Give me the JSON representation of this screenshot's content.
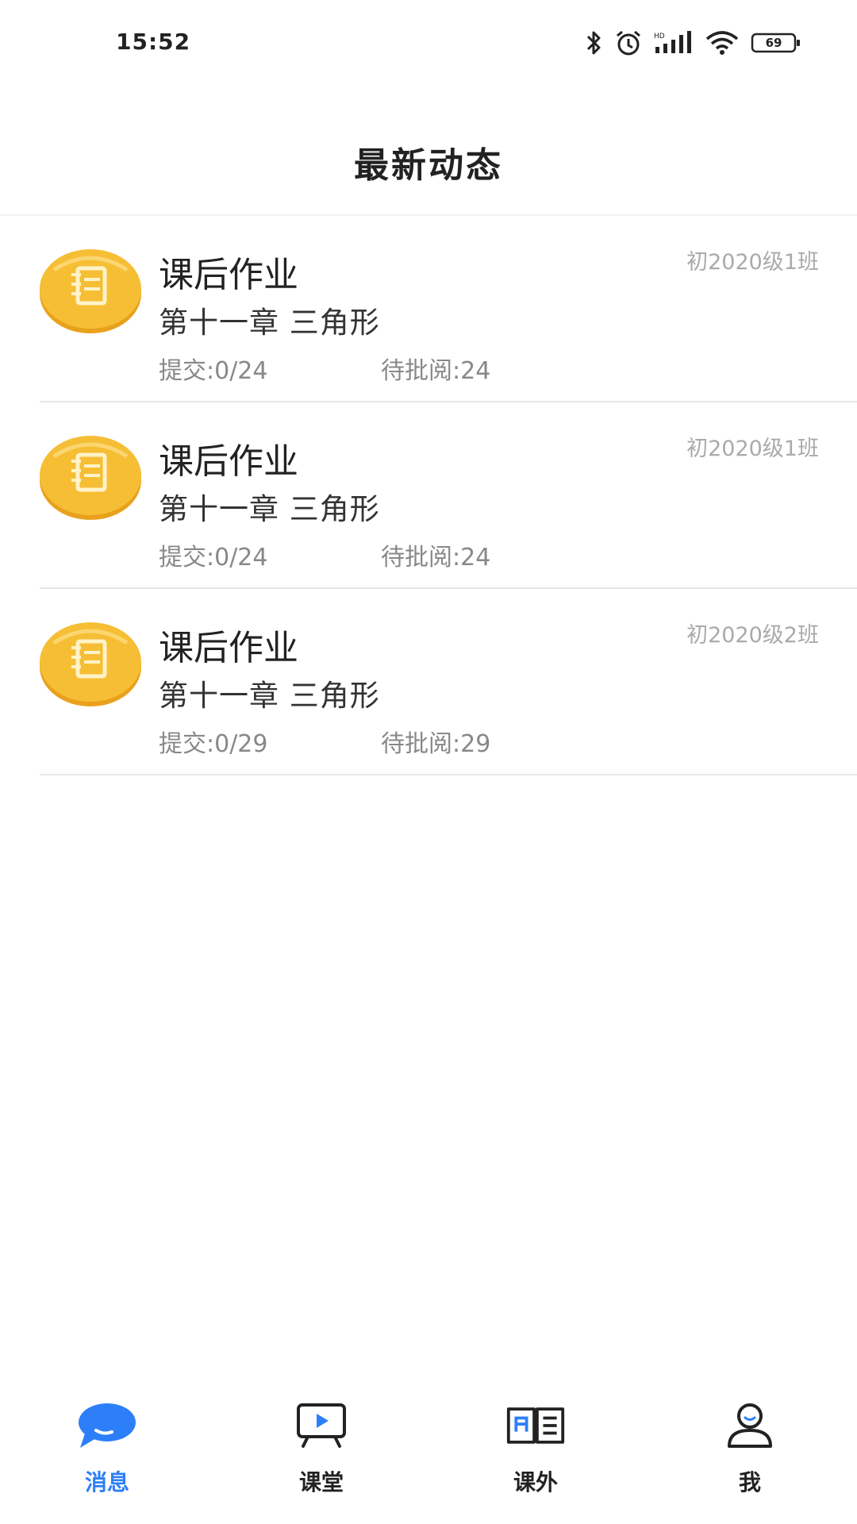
{
  "status_bar": {
    "time": "15:52",
    "icons": [
      "bluetooth-icon",
      "alarm-icon",
      "signal-icon",
      "wifi-icon",
      "battery-icon"
    ],
    "battery_level": "69"
  },
  "header": {
    "title": "最新动态"
  },
  "items": [
    {
      "title": "课后作业",
      "subtitle": "第十一章 三角形",
      "submitted": "提交:0/24",
      "pending": "待批阅:24",
      "class": "初2020级1班",
      "icon": "notebook-icon"
    },
    {
      "title": "课后作业",
      "subtitle": "第十一章 三角形",
      "submitted": "提交:0/24",
      "pending": "待批阅:24",
      "class": "初2020级1班",
      "icon": "notebook-icon"
    },
    {
      "title": "课后作业",
      "subtitle": "第十一章 三角形",
      "submitted": "提交:0/29",
      "pending": "待批阅:29",
      "class": "初2020级2班",
      "icon": "notebook-icon"
    }
  ],
  "tabs": [
    {
      "label": "消息",
      "icon": "message-icon",
      "active": true
    },
    {
      "label": "课堂",
      "icon": "classroom-icon",
      "active": false
    },
    {
      "label": "课外",
      "icon": "book-icon",
      "active": false
    },
    {
      "label": "我",
      "icon": "profile-icon",
      "active": false
    }
  ],
  "colors": {
    "accent": "#2d7ff9",
    "icon_gold": "#f5b92e",
    "muted": "#888888"
  }
}
